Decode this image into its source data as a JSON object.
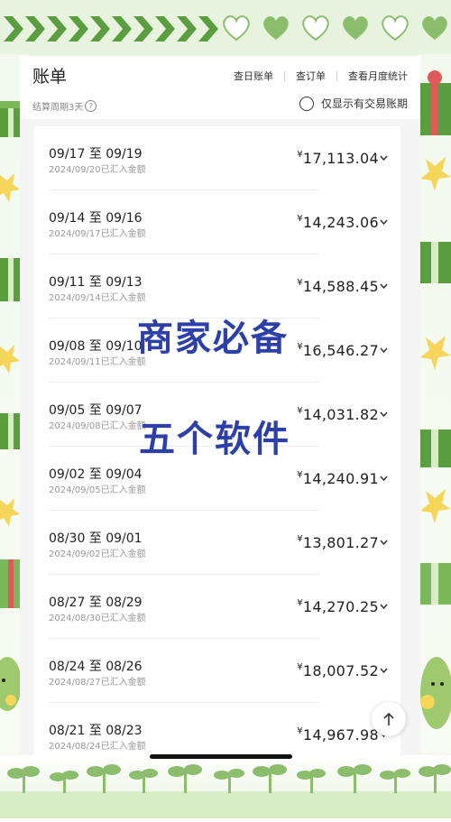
{
  "header": {
    "title": "账单",
    "links": [
      "查日账单",
      "查订单",
      "查看月度统计"
    ],
    "cycle_label": "结算周期3天",
    "only_trading_label": "仅显示有交易账期"
  },
  "bills": [
    {
      "period": "09/17 至 09/19",
      "sub": "2024/09/20已汇入金额",
      "amount": "17,113.04"
    },
    {
      "period": "09/14 至 09/16",
      "sub": "2024/09/17已汇入金额",
      "amount": "14,243.06"
    },
    {
      "period": "09/11 至 09/13",
      "sub": "2024/09/14已汇入金额",
      "amount": "14,588.45"
    },
    {
      "period": "09/08 至 09/10",
      "sub": "2024/09/11已汇入金额",
      "amount": "16,546.27"
    },
    {
      "period": "09/05 至 09/07",
      "sub": "2024/09/08已汇入金额",
      "amount": "14,031.82"
    },
    {
      "period": "09/02 至 09/04",
      "sub": "2024/09/05已汇入金额",
      "amount": "14,240.91"
    },
    {
      "period": "08/30 至 09/01",
      "sub": "2024/09/02已汇入金额",
      "amount": "13,801.27"
    },
    {
      "period": "08/27 至 08/29",
      "sub": "2024/08/30已汇入金额",
      "amount": "14,270.25"
    },
    {
      "period": "08/24 至 08/26",
      "sub": "2024/08/27已汇入金额",
      "amount": "18,007.52"
    },
    {
      "period": "08/21 至 08/23",
      "sub": "2024/08/24已汇入金额",
      "amount": "14,967.98"
    }
  ],
  "currency_symbol": "¥",
  "overlay": {
    "line1": "商家必备",
    "line2": "五个软件"
  },
  "colors": {
    "frame_green": "#8cbd6c",
    "overlay_blue": "#2d3fa8",
    "star": "#f5d55a"
  },
  "icons": {
    "scroll_top": "arrow-up-icon",
    "expand": "chevron-down-icon"
  }
}
